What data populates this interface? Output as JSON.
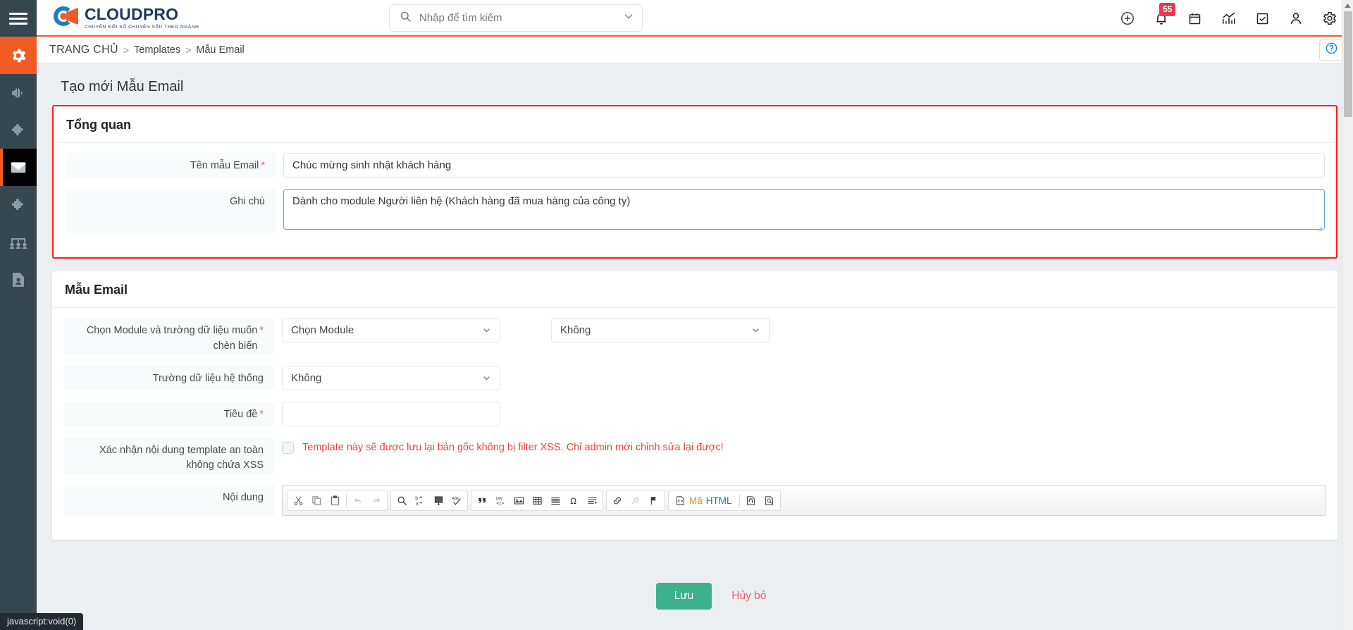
{
  "brand": {
    "name": "CLOUDPRO",
    "tagline": "CHUYỂN ĐỔI SỐ CHUYÊN SÂU THEO NGÀNH",
    "accent": "#f15a24",
    "navy": "#1f3864"
  },
  "search": {
    "placeholder": "Nhập để tìm kiếm",
    "value": ""
  },
  "topbar": {
    "icons": [
      {
        "name": "add-circle-icon",
        "label": "Thêm mới"
      },
      {
        "name": "bell-icon",
        "label": "Thông báo",
        "badge": "55"
      },
      {
        "name": "calendar-icon",
        "label": "Lịch"
      },
      {
        "name": "analytics-icon",
        "label": "Báo cáo"
      },
      {
        "name": "task-check-icon",
        "label": "Công việc"
      },
      {
        "name": "user-icon",
        "label": "Tài khoản"
      },
      {
        "name": "gear-icon",
        "label": "Cài đặt"
      }
    ]
  },
  "sidebar": {
    "items": [
      {
        "name": "settings",
        "icon": "gear-icon",
        "state": "active-orange"
      },
      {
        "name": "marketing",
        "icon": "megaphone-icon",
        "state": "normal"
      },
      {
        "name": "modules",
        "icon": "puzzle-icon",
        "state": "normal"
      },
      {
        "name": "email",
        "icon": "envelope-icon",
        "state": "active-dark"
      },
      {
        "name": "extensions",
        "icon": "puzzle-icon",
        "state": "normal"
      },
      {
        "name": "organization",
        "icon": "org-chart-icon",
        "state": "normal"
      },
      {
        "name": "contacts",
        "icon": "id-card-icon",
        "state": "normal"
      }
    ]
  },
  "breadcrumb": {
    "home": "TRANG CHỦ",
    "separator": ">",
    "middle": "Templates",
    "current": "Mẫu Email"
  },
  "page": {
    "title": "Tạo mới Mẫu Email"
  },
  "overview": {
    "heading": "Tổng quan",
    "name_label": "Tên mẫu Email",
    "name_value": "Chúc mừng sinh nhật khách hàng",
    "note_label": "Ghi chú",
    "note_value": "Dành cho module Người liên hệ (Khách hàng đã mua hàng của công ty)"
  },
  "template": {
    "heading": "Mẫu Email",
    "module_label": "Chọn Module và trường dữ liệu muốn chèn biến",
    "module_value": "Chọn Module",
    "field_value": "Không",
    "system_field_label": "Trường dữ liệu hệ thống",
    "system_field_value": "Không",
    "subject_label": "Tiêu đề",
    "subject_value": "",
    "xss_label": "Xác nhận nội dung template an toàn không chứa XSS",
    "xss_warning": "Template này sẽ được lưu lại bản gốc không bị filter XSS. Chỉ admin mới chỉnh sửa lại được!",
    "content_label": "Nội dung",
    "warning_color": "#f2403d"
  },
  "editor": {
    "groups": [
      {
        "buttons": [
          {
            "name": "cut-icon",
            "label": "Cắt",
            "dim": false
          },
          {
            "name": "copy-icon",
            "label": "Sao chép",
            "dim": false
          },
          {
            "name": "paste-icon",
            "label": "Dán",
            "dim": false
          },
          {
            "name": "undo-icon",
            "label": "Hoàn tác",
            "dim": true
          },
          {
            "name": "redo-icon",
            "label": "Làm lại",
            "dim": true
          }
        ]
      },
      {
        "buttons": [
          {
            "name": "find-icon",
            "label": "Tìm kiếm",
            "dim": false
          },
          {
            "name": "replace-icon",
            "label": "Thay thế",
            "dim": false
          },
          {
            "name": "select-all-icon",
            "label": "Chọn tất cả",
            "dim": false
          },
          {
            "name": "spellcheck-icon",
            "label": "Kiểm tra chính tả",
            "dim": false
          }
        ]
      },
      {
        "buttons": [
          {
            "name": "blockquote-icon",
            "label": "Trích dẫn",
            "dim": false
          },
          {
            "name": "create-div-icon",
            "label": "Tạo Div",
            "dim": false
          },
          {
            "name": "image-icon",
            "label": "Hình ảnh",
            "dim": false
          },
          {
            "name": "table-icon",
            "label": "Bảng",
            "dim": false
          },
          {
            "name": "horizontal-rule-icon",
            "label": "Đường kẻ ngang",
            "dim": false
          },
          {
            "name": "special-char-icon",
            "label": "Ký tự đặc biệt",
            "dim": false
          },
          {
            "name": "page-break-icon",
            "label": "Ngắt trang",
            "dim": false
          }
        ]
      },
      {
        "buttons": [
          {
            "name": "link-icon",
            "label": "Liên kết",
            "dim": false
          },
          {
            "name": "unlink-icon",
            "label": "Bỏ liên kết",
            "dim": true
          },
          {
            "name": "anchor-icon",
            "label": "Neo",
            "dim": false
          }
        ]
      },
      {
        "buttons": [
          {
            "name": "source-code-icon",
            "label_ma": "Mã",
            "label_html": "HTML",
            "dim": false
          },
          {
            "name": "maximize-icon",
            "label": "Phóng to",
            "dim": false
          },
          {
            "name": "preview-icon",
            "label": "Xem trước",
            "dim": false
          }
        ]
      }
    ],
    "source_label_ma": "Mã",
    "source_label_html": "HTML"
  },
  "actions": {
    "save": "Lưu",
    "cancel": "Hủy bỏ",
    "save_color": "#3bb18c",
    "cancel_color": "#ef5a6b"
  },
  "statusbar": {
    "url": "javascript:void(0)"
  }
}
